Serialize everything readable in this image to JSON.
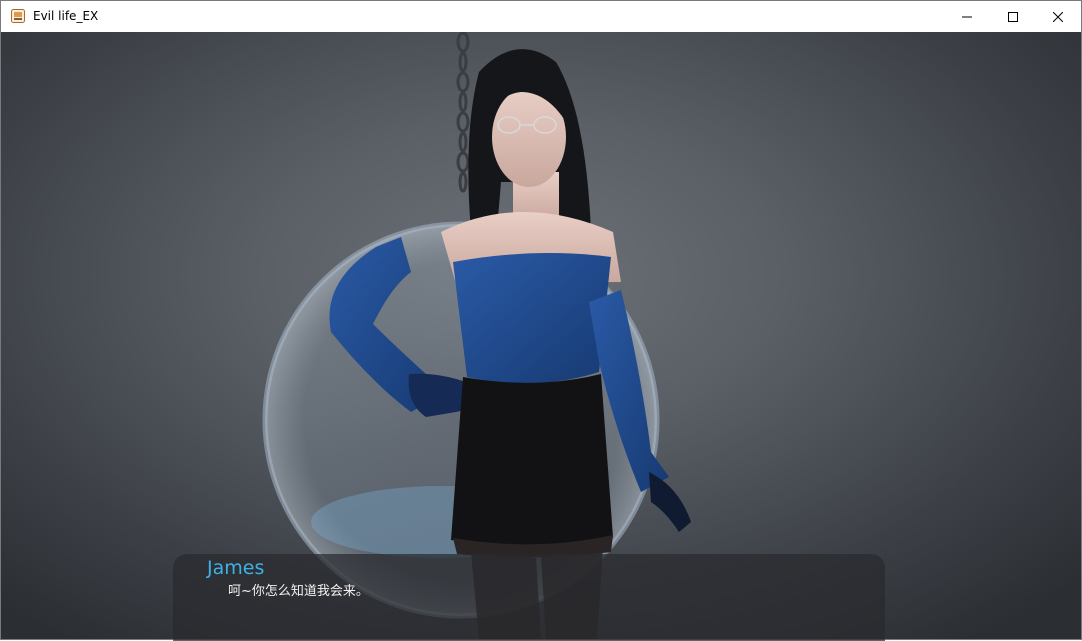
{
  "window": {
    "title": "Evil life_EX",
    "app_icon": "game-app-icon",
    "controls": {
      "minimize_icon": "minimize-icon",
      "maximize_icon": "maximize-icon",
      "close_icon": "close-icon"
    }
  },
  "scene": {
    "background_color": "#5a5f66",
    "character_outfit_color": "#1f4a8c",
    "skirt_color": "#111111"
  },
  "dialogue": {
    "speaker": "James",
    "text": "呵~你怎么知道我会来。",
    "speaker_color": "#3fb1e6",
    "box_color": "#282a2e"
  }
}
